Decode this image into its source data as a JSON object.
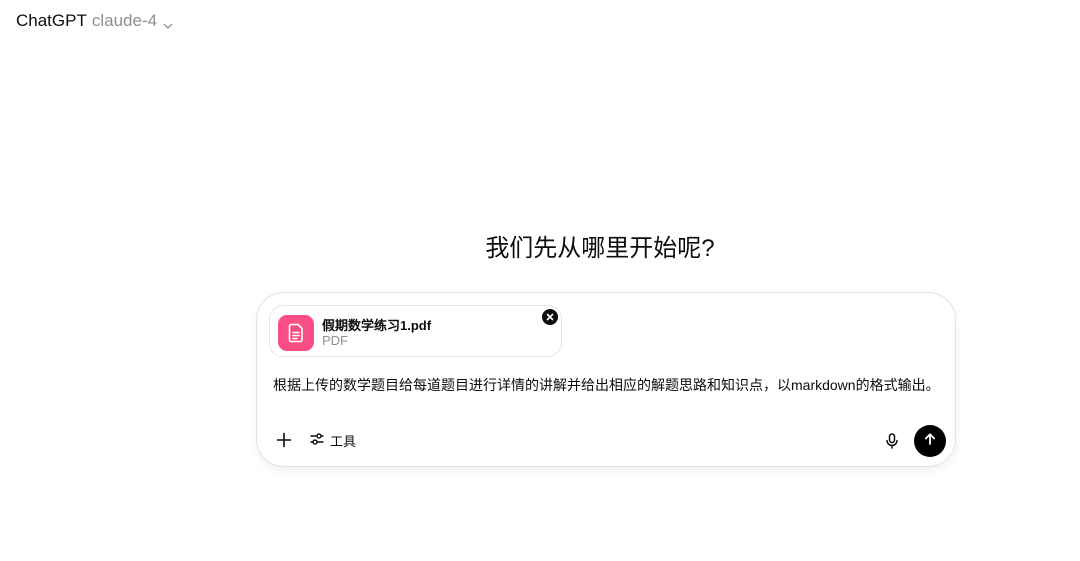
{
  "header": {
    "app_name": "ChatGPT",
    "model_name": "claude-4",
    "chevron_icon": "chevron-down-icon"
  },
  "main": {
    "heading": "我们先从哪里开始呢?"
  },
  "composer": {
    "attachment": {
      "file_name": "假期数学练习1.pdf",
      "file_type": "PDF",
      "icon": "document-icon",
      "icon_color": "#fa4f84",
      "remove_icon": "close-icon"
    },
    "prompt": "根据上传的数学题目给每道题目进行详情的讲解并给出相应的解题思路和知识点，以markdown的格式输出。",
    "add_icon": "plus-icon",
    "tools_label": "工具",
    "tools_icon": "sliders-icon",
    "mic_icon": "microphone-icon",
    "send_icon": "arrow-up-icon",
    "send_color": "#000000"
  }
}
